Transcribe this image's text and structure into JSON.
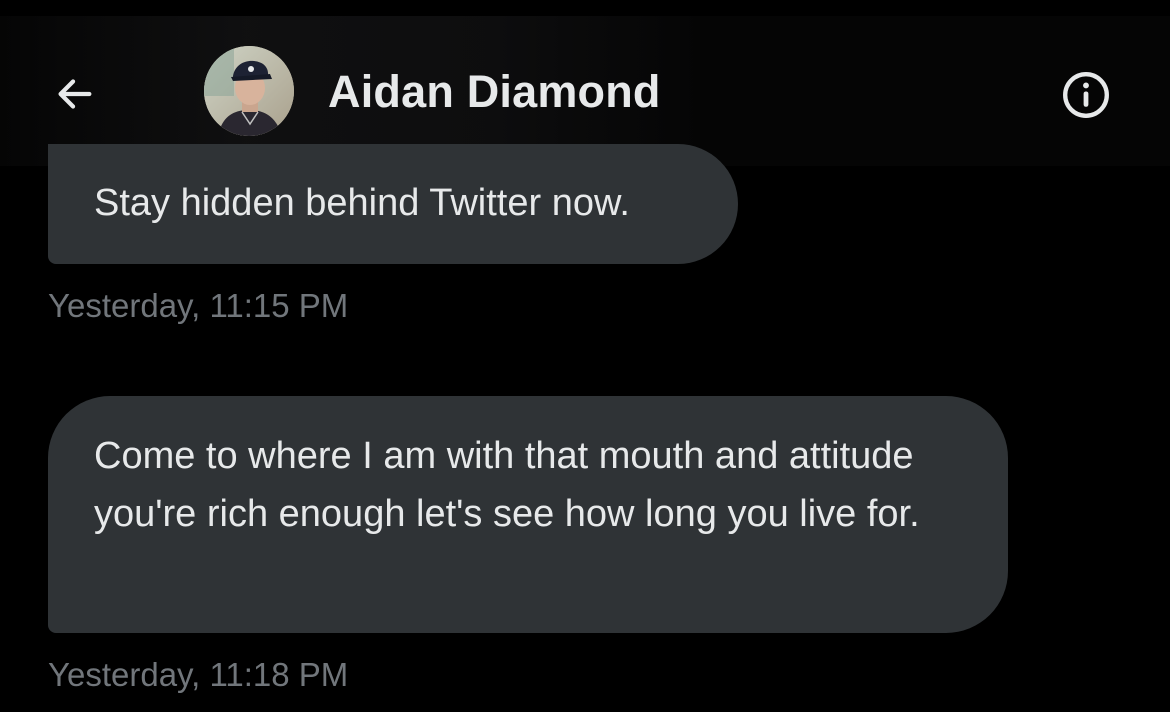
{
  "header": {
    "contact_name": "Aidan Diamond",
    "back_icon": "arrow-left-icon",
    "info_icon": "info-circle-icon"
  },
  "messages": [
    {
      "text": "Stay hidden behind Twitter now.",
      "timestamp": "Yesterday, 11:15 PM"
    },
    {
      "text": "Come to where I am with that mouth and attitude you're rich enough let's see how long you live for.",
      "timestamp": "Yesterday, 11:18 PM"
    }
  ],
  "colors": {
    "background": "#000000",
    "bubble": "#2f3336",
    "text": "#e7e9ea",
    "timestamp": "#71767b"
  }
}
